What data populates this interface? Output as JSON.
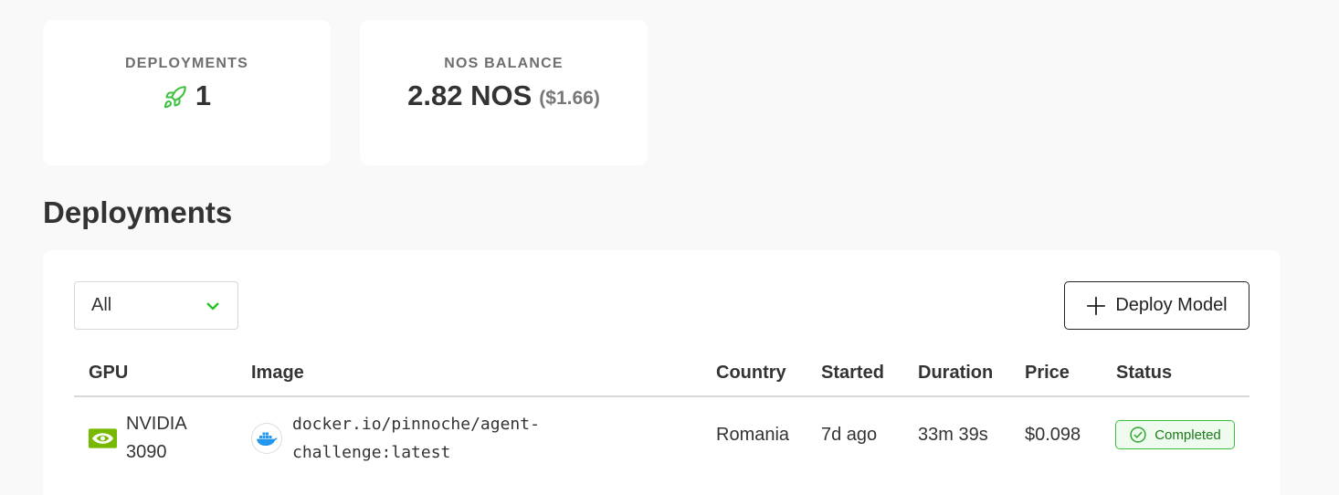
{
  "stats": {
    "deployments": {
      "label": "DEPLOYMENTS",
      "value": "1",
      "icon": "rocket-icon"
    },
    "balance": {
      "label": "NOS BALANCE",
      "value": "2.82 NOS",
      "usd": "($1.66)"
    }
  },
  "section": {
    "title": "Deployments"
  },
  "filter": {
    "selected": "All"
  },
  "actions": {
    "deploy_label": "Deploy Model"
  },
  "table": {
    "columns": [
      "GPU",
      "Image",
      "Country",
      "Started",
      "Duration",
      "Price",
      "Status"
    ],
    "rows": [
      {
        "gpu_line1": "NVIDIA",
        "gpu_line2": "3090",
        "image_line1": "docker.io/pinnoche/agent-",
        "image_line2": "challenge:latest",
        "country": "Romania",
        "started": "7d ago",
        "duration": "33m 39s",
        "price": "$0.098",
        "status": "Completed"
      }
    ]
  },
  "colors": {
    "accent_green": "#3cc13c",
    "nvidia_green": "#76b900",
    "docker_blue": "#2496ed"
  }
}
